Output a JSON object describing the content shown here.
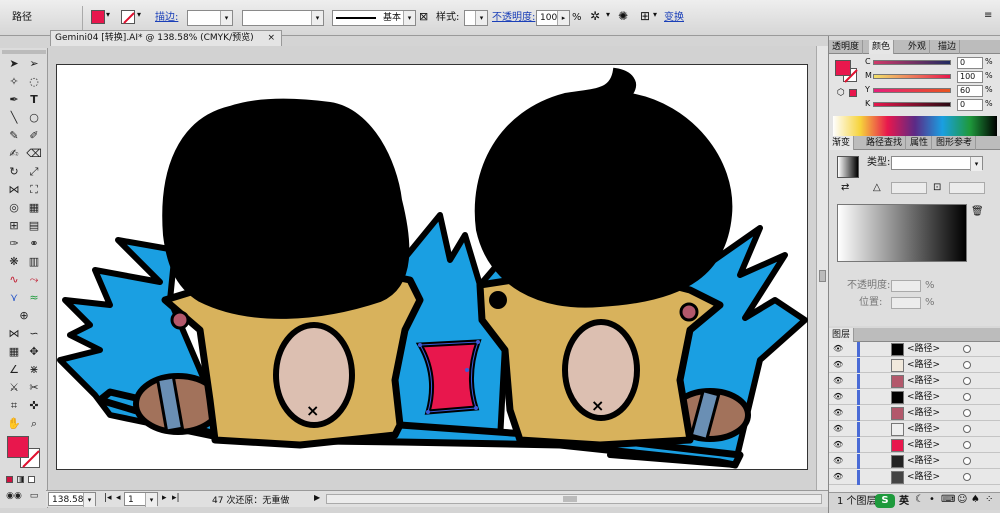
{
  "control_bar": {
    "mode_label": "路径",
    "fill_color": "#e8174d",
    "stroke_label": "描边:",
    "stroke_weight": "",
    "brush_label": "基本",
    "style_label": "样式:",
    "opacity_label": "不透明度:",
    "opacity_value": "100",
    "opacity_unit": "%",
    "transform_label": "变换"
  },
  "document_tab": {
    "title": "Gemini04 [转换].AI* @ 138.58% (CMYK/预览)",
    "close": "×"
  },
  "status_bar": {
    "zoom": "138.58%",
    "page": "1",
    "undo_text": "47 次还原：无重做"
  },
  "color_panel": {
    "tabs": [
      "透明度",
      "颜色",
      "外观",
      "描边"
    ],
    "channels": [
      {
        "label": "C",
        "value": "0"
      },
      {
        "label": "M",
        "value": "100"
      },
      {
        "label": "Y",
        "value": "60"
      },
      {
        "label": "K",
        "value": "0"
      }
    ],
    "fill_color": "#e8174d"
  },
  "gradient_panel": {
    "tabs": [
      "渐变",
      "路径查找",
      "属性",
      "图形参考"
    ],
    "type_label": "类型:",
    "opacity_label": "不透明度:",
    "position_label": "位置:",
    "unit": "%"
  },
  "layers_panel": {
    "tab": "图层",
    "rows": [
      {
        "name": "<路径>",
        "thumb": "#000000"
      },
      {
        "name": "<路径>",
        "thumb": "#f1e9dc"
      },
      {
        "name": "<路径>",
        "thumb": "#b3586b"
      },
      {
        "name": "<路径>",
        "thumb": "#000000"
      },
      {
        "name": "<路径>",
        "thumb": "#b3586b"
      },
      {
        "name": "<路径>",
        "thumb": "#eeeeee"
      },
      {
        "name": "<路径>",
        "thumb": "#e8174d"
      },
      {
        "name": "<路径>",
        "thumb": "#222222"
      },
      {
        "name": "<路径>",
        "thumb": "#444444"
      }
    ],
    "footer": "1 个图层"
  },
  "tray": {
    "lang_label": "英"
  },
  "colors": {
    "hair": "#000000",
    "skin": "#d8b25c",
    "blue": "#1a9fe2",
    "pink_face": "#dcbfb1",
    "cheek": "#b3586b",
    "shoe": "#a2725b",
    "shoe_band": "#6a8fb4",
    "center": "#e8174d",
    "selection": "#3a5bd9"
  }
}
